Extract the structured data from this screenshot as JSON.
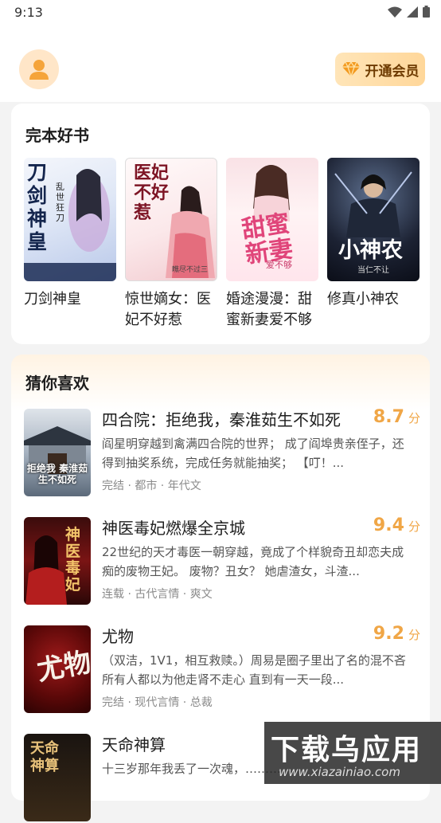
{
  "status_bar": {
    "time": "9:13"
  },
  "header": {
    "vip_label": "开通会员"
  },
  "finished_books": {
    "title": "完本好书",
    "books": [
      {
        "title": "刀剑神皇",
        "cover_text": "刀剑神皇",
        "cover_author": "乱世狂刀"
      },
      {
        "title": "惊世嫡女：医妃不好惹",
        "cover_text": "医妃不好惹",
        "cover_author": "瞧尽不过三"
      },
      {
        "title": "婚途漫漫：甜蜜新妻爱不够",
        "cover_text": "甜蜜新妻",
        "cover_author": "爱不够"
      },
      {
        "title": "修真小神农",
        "cover_text": "小神农",
        "cover_author": "当仁不让"
      }
    ]
  },
  "recommend": {
    "title": "猜你喜欢",
    "items": [
      {
        "title": "四合院：拒绝我，秦淮茹生不如死",
        "score": "8.7",
        "unit": "分",
        "desc": "阎星明穿越到禽满四合院的世界； 成了阎埠贵亲侄子，还得到抽奖系统，完成任务就能抽奖； 【叮！...",
        "tags": "完结 · 都市 · 年代文",
        "cover_text": "拒绝我 秦淮茹 生不如死"
      },
      {
        "title": "神医毒妃燃爆全京城",
        "score": "9.4",
        "unit": "分",
        "desc": "22世纪的天才毒医一朝穿越，竟成了个样貌奇丑却恋夫成痴的废物王妃。 废物？丑女？ 她虐渣女，斗渣...",
        "tags": "连载 · 古代言情 · 爽文",
        "cover_text": "神医毒妃"
      },
      {
        "title": "尤物",
        "score": "9.2",
        "unit": "分",
        "desc": "（双洁，1V1，相互救赎。）周易是圈子里出了名的混不吝 所有人都以为他走肾不走心 直到有一天一段...",
        "tags": "完结 · 现代言情 · 总裁",
        "cover_text": "尤物"
      },
      {
        "title": "天命神算",
        "score": "",
        "unit": "",
        "desc": "十三岁那年我丢了一次魂，…………",
        "tags": "",
        "cover_text": "天命神算"
      }
    ]
  },
  "watermark": {
    "text": "下载乌应用",
    "url": "www.xiazainiao.com"
  },
  "colors": {
    "accent": "#f0a646",
    "vip_text": "#6e3b00"
  }
}
